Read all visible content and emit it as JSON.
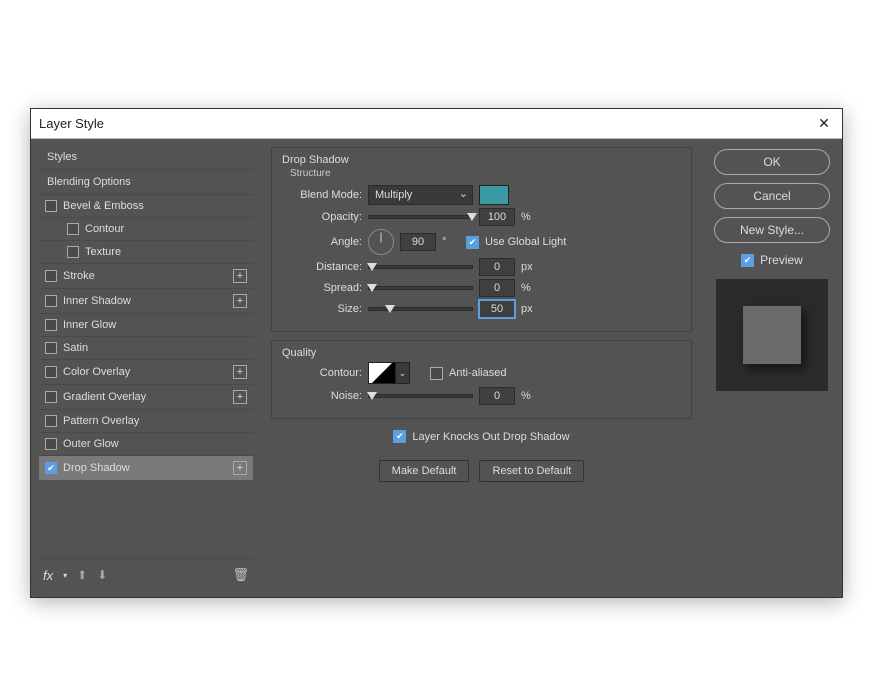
{
  "dialog": {
    "title": "Layer Style"
  },
  "sidebar": {
    "styles_header": "Styles",
    "blending_header": "Blending Options",
    "items": [
      {
        "label": "Bevel & Emboss",
        "checked": false,
        "plus": false
      },
      {
        "label": "Contour",
        "checked": false,
        "plus": false,
        "sub": true
      },
      {
        "label": "Texture",
        "checked": false,
        "plus": false,
        "sub": true
      },
      {
        "label": "Stroke",
        "checked": false,
        "plus": true
      },
      {
        "label": "Inner Shadow",
        "checked": false,
        "plus": true
      },
      {
        "label": "Inner Glow",
        "checked": false,
        "plus": false
      },
      {
        "label": "Satin",
        "checked": false,
        "plus": false
      },
      {
        "label": "Color Overlay",
        "checked": false,
        "plus": true
      },
      {
        "label": "Gradient Overlay",
        "checked": false,
        "plus": true
      },
      {
        "label": "Pattern Overlay",
        "checked": false,
        "plus": false
      },
      {
        "label": "Outer Glow",
        "checked": false,
        "plus": false
      },
      {
        "label": "Drop Shadow",
        "checked": true,
        "plus": true,
        "active": true
      }
    ],
    "fx": "fx"
  },
  "main": {
    "section_title": "Drop Shadow",
    "structure_label": "Structure",
    "blend_mode_label": "Blend Mode:",
    "blend_mode_value": "Multiply",
    "swatch_color": "#3a9aa3",
    "opacity_label": "Opacity:",
    "opacity_value": "100",
    "opacity_unit": "%",
    "angle_label": "Angle:",
    "angle_value": "90",
    "angle_unit": "°",
    "use_global_light": "Use Global Light",
    "use_global_light_checked": true,
    "distance_label": "Distance:",
    "distance_value": "0",
    "distance_unit": "px",
    "spread_label": "Spread:",
    "spread_value": "0",
    "spread_unit": "%",
    "size_label": "Size:",
    "size_value": "50",
    "size_unit": "px",
    "quality_label": "Quality",
    "contour_label": "Contour:",
    "anti_aliased": "Anti-aliased",
    "anti_aliased_checked": false,
    "noise_label": "Noise:",
    "noise_value": "0",
    "noise_unit": "%",
    "knockout": "Layer Knocks Out Drop Shadow",
    "knockout_checked": true,
    "make_default": "Make Default",
    "reset_default": "Reset to Default"
  },
  "right": {
    "ok": "OK",
    "cancel": "Cancel",
    "new_style": "New Style...",
    "preview": "Preview",
    "preview_checked": true
  }
}
